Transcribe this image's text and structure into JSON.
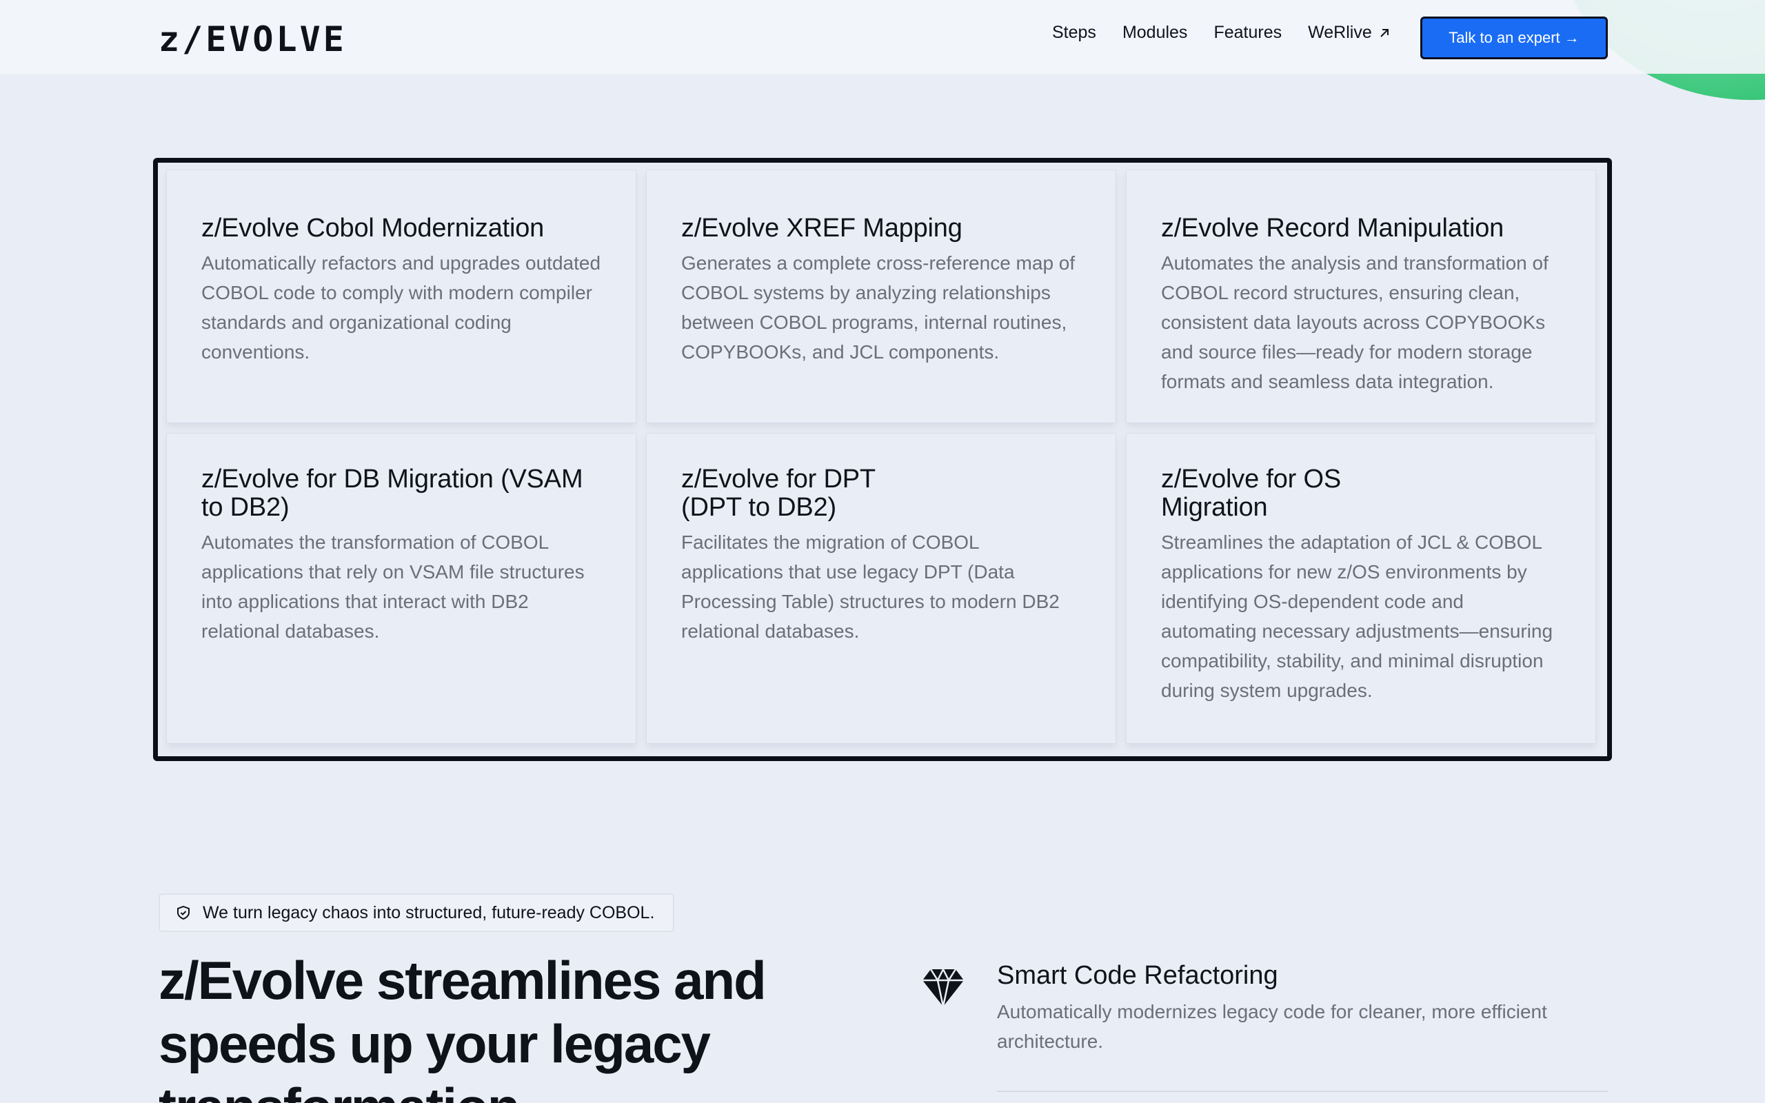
{
  "header": {
    "logo": "z/EVOLVE",
    "nav": [
      {
        "label": "Steps"
      },
      {
        "label": "Modules"
      },
      {
        "label": "Features"
      },
      {
        "label": "WeRlive",
        "external": true
      }
    ],
    "cta_label": "Talk to an expert →",
    "cta_color": "#1a6cf5"
  },
  "modules": [
    {
      "title": "z/Evolve Cobol Modernization",
      "description": "Automatically refactors and upgrades outdated COBOL code to comply with modern compiler standards and organizational coding conventions."
    },
    {
      "title": "z/Evolve XREF Mapping",
      "description": "Generates a complete cross-reference map of COBOL systems by analyzing relationships between COBOL programs, internal routines, COPYBOOKs, and JCL components."
    },
    {
      "title": "z/Evolve Record Manipulation",
      "description": "Automates the analysis and transformation of COBOL record structures, ensuring clean, consistent data layouts across COPYBOOKs and source files—ready for modern storage formats and seamless data integration."
    },
    {
      "title": "z/Evolve for DB Migration (VSAM to DB2)",
      "description": "Automates the transformation of COBOL applications that rely on VSAM file structures into applications that interact with DB2 relational databases."
    },
    {
      "title": "z/Evolve for DPT\n(DPT to DB2)",
      "description": "Facilitates the migration of COBOL applications that use legacy DPT (Data Processing Table) structures to modern DB2 relational databases."
    },
    {
      "title": "z/Evolve for OS\nMigration",
      "description": "Streamlines the adaptation of JCL & COBOL applications for new z/OS environments by identifying OS-dependent code and automating necessary adjustments—ensuring compatibility, stability, and minimal disruption during system upgrades."
    }
  ],
  "section": {
    "badge_icon": "shield-icon",
    "badge": "We turn legacy chaos into structured, future-ready COBOL.",
    "headline": "z/Evolve streamlines and speeds up your legacy transformation",
    "feature": {
      "icon": "diamond-icon",
      "title": "Smart Code Refactoring",
      "description": "Automatically modernizes legacy code for cleaner, more efficient architecture."
    }
  },
  "colors": {
    "background": "#e9eef6",
    "accent_green": "#1fbd69",
    "text_muted": "#6b6f77"
  }
}
